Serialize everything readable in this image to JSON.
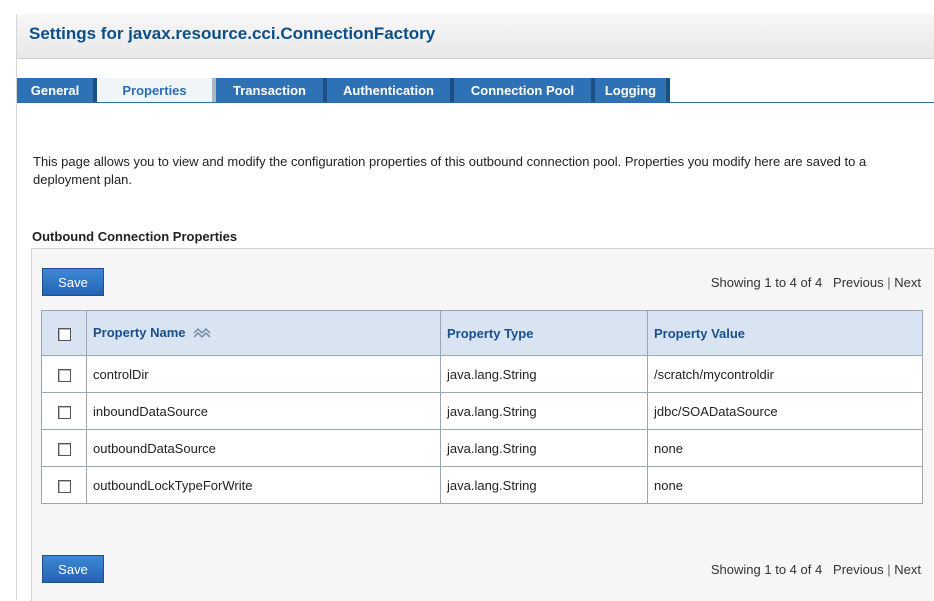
{
  "page": {
    "title": "Settings for javax.resource.cci.ConnectionFactory"
  },
  "tabs": [
    {
      "label": "General",
      "active": false
    },
    {
      "label": "Properties",
      "active": true
    },
    {
      "label": "Transaction",
      "active": false
    },
    {
      "label": "Authentication",
      "active": false
    },
    {
      "label": "Connection Pool",
      "active": false
    },
    {
      "label": "Logging",
      "active": false
    }
  ],
  "intro": "This page allows you to view and modify the configuration properties of this outbound connection pool. Properties you modify here are saved to a deployment plan.",
  "section": {
    "title": "Outbound Connection Properties"
  },
  "toolbar": {
    "save_label": "Save",
    "showing": "Showing 1 to 4 of 4",
    "previous": "Previous",
    "separator": "|",
    "next": "Next"
  },
  "table": {
    "columns": [
      "Property Name",
      "Property Type",
      "Property Value"
    ],
    "sort_icon": "sort-ascending-icon",
    "rows": [
      {
        "name": "controlDir",
        "type": "java.lang.String",
        "value": "/scratch/mycontroldir"
      },
      {
        "name": "inboundDataSource",
        "type": "java.lang.String",
        "value": "jdbc/SOADataSource"
      },
      {
        "name": "outboundDataSource",
        "type": "java.lang.String",
        "value": "none"
      },
      {
        "name": "outboundLockTypeForWrite",
        "type": "java.lang.String",
        "value": "none"
      }
    ]
  },
  "colors": {
    "title": "#0b4f8a",
    "tab_active_text": "#2b6eb3",
    "tab_bg": "#2f71b5",
    "button_bg": "#2f71c0",
    "table_header_bg": "#d8e4f1"
  }
}
